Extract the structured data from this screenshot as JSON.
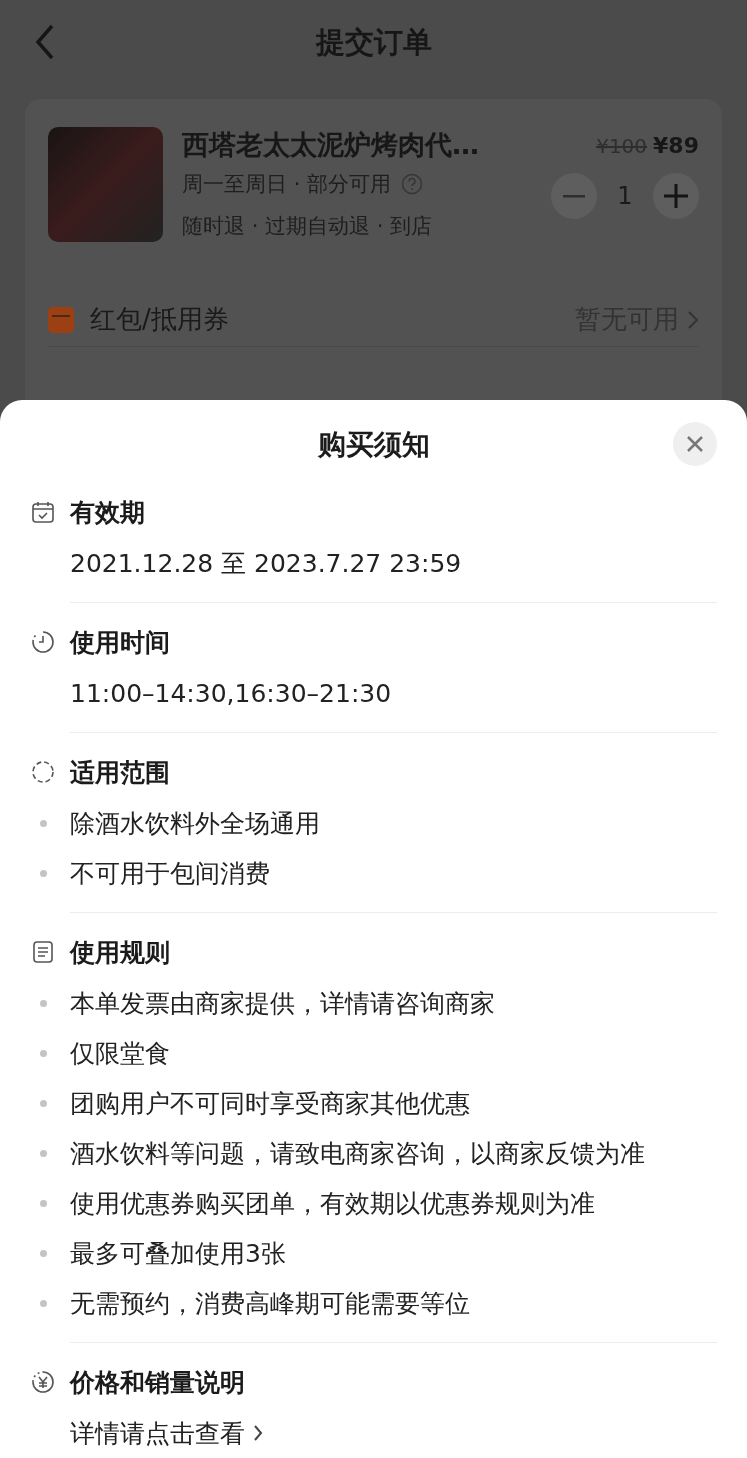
{
  "header": {
    "title": "提交订单"
  },
  "product": {
    "name": "西塔老太太泥炉烤肉代…",
    "original_price": "¥100",
    "price": "¥89",
    "usage_days": "周一至周日 · 部分可用",
    "refund": "随时退 · 过期自动退 · 到店",
    "quantity": "1"
  },
  "coupon": {
    "label": "红包/抵用券",
    "status": "暂无可用"
  },
  "sheet": {
    "title": "购买须知",
    "sections": [
      {
        "kind": "plain",
        "title": "有效期",
        "items": [
          "2021.12.28 至 2023.7.27 23:59"
        ]
      },
      {
        "kind": "plain",
        "title": "使用时间",
        "items": [
          "11:00–14:30,16:30–21:30"
        ]
      },
      {
        "kind": "bullets",
        "title": "适用范围",
        "items": [
          "除酒水饮料外全场通用",
          "不可用于包间消费"
        ]
      },
      {
        "kind": "bullets",
        "title": "使用规则",
        "items": [
          "本单发票由商家提供，详情请咨询商家",
          "仅限堂食",
          "团购用户不可同时享受商家其他优惠",
          "酒水饮料等问题，请致电商家咨询，以商家反馈为准",
          "使用优惠券购买团单，有效期以优惠券规则为准",
          "最多可叠加使用3张",
          "无需预约，消费高峰期可能需要等位"
        ]
      },
      {
        "kind": "link",
        "title": "价格和销量说明",
        "items": [
          "详情请点击查看"
        ]
      }
    ]
  }
}
